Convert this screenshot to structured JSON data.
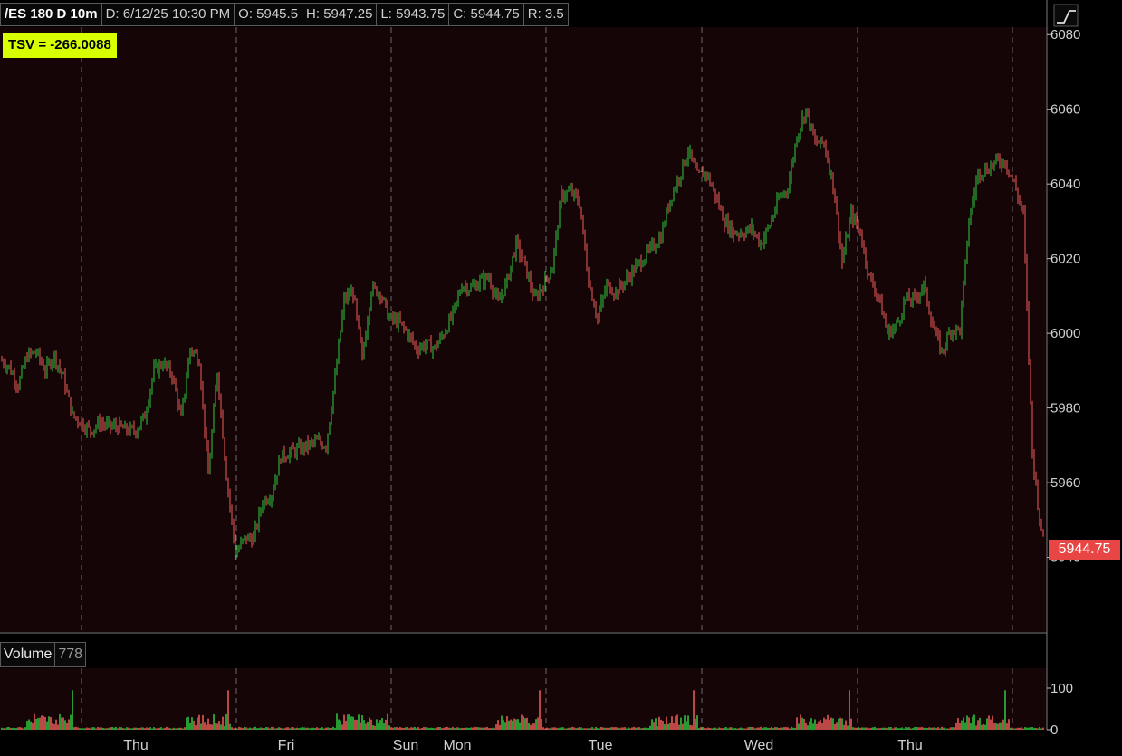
{
  "header": {
    "symbol": "/ES 180 D 10m",
    "date": "D: 6/12/25 10:30 PM",
    "open": "O: 5945.5",
    "high": "H: 5947.25",
    "low": "L: 5943.75",
    "close": "C: 5944.75",
    "range": "R: 3.5"
  },
  "study_label": "TSV = -266.0088",
  "last_price_label": "5944.75",
  "volume_panel": {
    "label": "Volume",
    "value": "778"
  },
  "colors": {
    "background": "#150506",
    "up": "#2ecc40",
    "down": "#f25f5c",
    "tsv": "#d7ff00",
    "last_price": "#e84545",
    "grid": "#6a6a6a"
  },
  "chart_data": {
    "type": "candlestick",
    "title": "/ES 180 D 10m",
    "price_axis": {
      "ylim": [
        5920,
        6082
      ],
      "ticks": [
        5940,
        5960,
        5980,
        6000,
        6020,
        6040,
        6060,
        6080
      ],
      "side": "right"
    },
    "x_axis": {
      "day_labels": [
        "Thu",
        "Fri",
        "Sun",
        "Mon",
        "Tue",
        "Wed",
        "Thu"
      ],
      "session_breaks": 8
    },
    "price_path": {
      "x_index": [
        0,
        10,
        20,
        30,
        40,
        50,
        60,
        70,
        80,
        90,
        100,
        110,
        120,
        130,
        140,
        150,
        160,
        170,
        180,
        190,
        200,
        210,
        220,
        230,
        240,
        250,
        260,
        270,
        280,
        290,
        300,
        310,
        320,
        330,
        340,
        350,
        360,
        370,
        380,
        390,
        400,
        410,
        420,
        430,
        440,
        450,
        460,
        470,
        480,
        490,
        500,
        510,
        520,
        530,
        540,
        550,
        560,
        570,
        580,
        590,
        600,
        610,
        620,
        630,
        640,
        650,
        660,
        670,
        680,
        690,
        700,
        710,
        720,
        730,
        740,
        750,
        760,
        770,
        780,
        790,
        800,
        810,
        820,
        830,
        840,
        850,
        860,
        870,
        880,
        890,
        900,
        910,
        920,
        930,
        940,
        950,
        960,
        970,
        980,
        990,
        1000,
        1010,
        1020,
        1030,
        1040,
        1050,
        1060,
        1070,
        1080,
        1090,
        1100,
        1110,
        1120,
        1130,
        1140,
        1150
      ],
      "close": [
        5993,
        5991,
        5986,
        5994,
        5995,
        5990,
        5994,
        5988,
        5978,
        5976,
        5974,
        5976,
        5975,
        5975,
        5974,
        5974,
        5978,
        5990,
        5992,
        5989,
        5977,
        5996,
        5993,
        5962,
        5990,
        5962,
        5941,
        5945,
        5945,
        5955,
        5957,
        5967,
        5968,
        5969,
        5970,
        5971,
        5970,
        5988,
        6009,
        6011,
        5993,
        6012,
        6011,
        6004,
        6003,
        6000,
        5996,
        5997,
        5996,
        6000,
        6005,
        6013,
        6012,
        6014,
        6015,
        6008,
        6014,
        6024,
        6018,
        6009,
        6013,
        6018,
        6037,
        6038,
        6035,
        6014,
        6004,
        6013,
        6011,
        6014,
        6017,
        6020,
        6023,
        6026,
        6036,
        6042,
        6049,
        6042,
        6043,
        6037,
        6030,
        6027,
        6027,
        6028,
        6024,
        6029,
        6036,
        6039,
        6053,
        6060,
        6051,
        6051,
        6040,
        6019,
        6032,
        6027,
        6015,
        6010,
        6000,
        6002,
        6009,
        6009,
        6013,
        6002,
        5995,
        6001,
        6001,
        6030,
        6043,
        6044,
        6046,
        6046,
        6040,
        6032,
        5968,
        5946
      ]
    },
    "volume_axis": {
      "ylim": [
        0,
        100
      ],
      "ticks": [
        0,
        100
      ]
    },
    "volume_series": {
      "name": "Volume",
      "last_value": 778
    }
  }
}
